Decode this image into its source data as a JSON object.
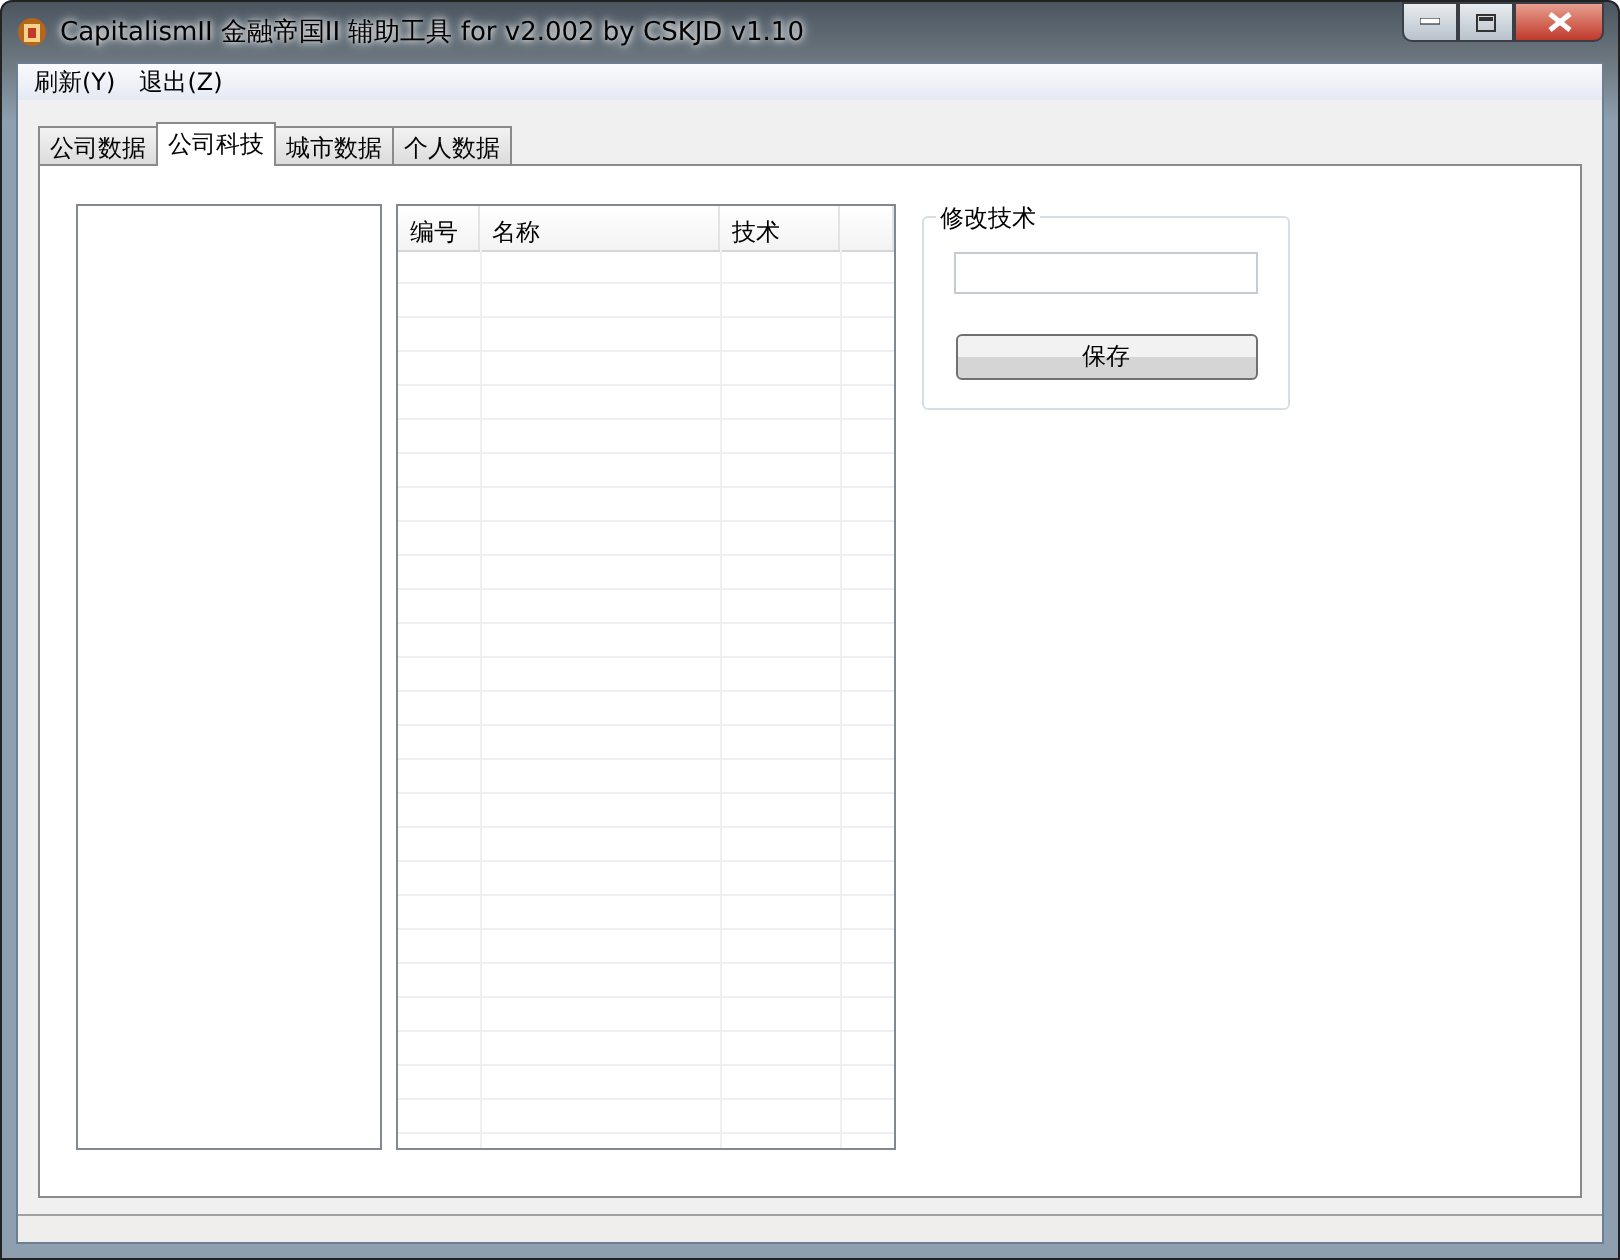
{
  "window": {
    "title": "CapitalismII 金融帝国II 辅助工具 for v2.002 by CSKJD v1.10"
  },
  "menu": [
    "刷新(Y)",
    "退出(Z)"
  ],
  "tabs": [
    {
      "label": "公司数据",
      "selected": false
    },
    {
      "label": "公司科技",
      "selected": true
    },
    {
      "label": "城市数据",
      "selected": false
    },
    {
      "label": "个人数据",
      "selected": false
    }
  ],
  "table": {
    "columns": [
      "编号",
      "名称",
      "技术"
    ]
  },
  "group": {
    "title": "修改技术",
    "button": "保存"
  }
}
